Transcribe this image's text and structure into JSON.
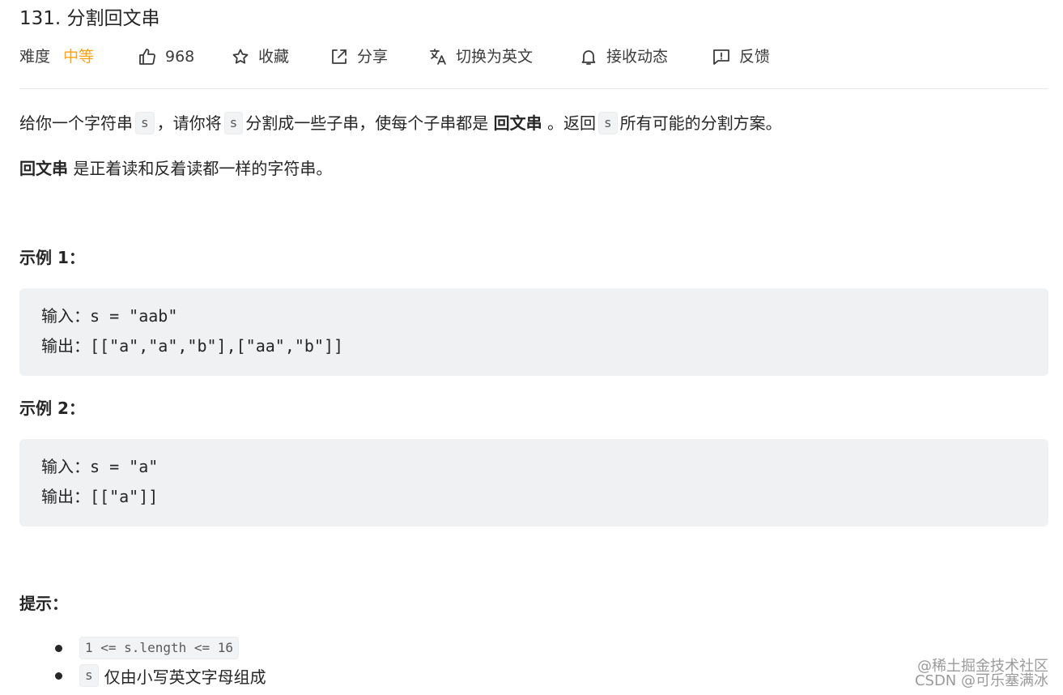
{
  "problem": {
    "title": "131. 分割回文串",
    "difficulty_label": "难度",
    "difficulty_value": "中等",
    "likes": "968",
    "favorite_label": "收藏",
    "share_label": "分享",
    "translate_label": "切换为英文",
    "notify_label": "接收动态",
    "feedback_label": "反馈"
  },
  "description": {
    "p1_part1": "给你一个字符串",
    "p1_code1": "s",
    "p1_part2": "，请你将",
    "p1_code2": "s",
    "p1_part3": "分割成一些子串，使每个子串都是",
    "p1_bold": "回文串",
    "p1_part4": "。返回",
    "p1_code3": "s",
    "p1_part5": "所有可能的分割方案。",
    "p2_bold": "回文串",
    "p2_rest": "是正着读和反着读都一样的字符串。"
  },
  "examples": [
    {
      "heading": "示例 1：",
      "input": "输入：s = \"aab\"",
      "output": "输出：[[\"a\",\"a\",\"b\"],[\"aa\",\"b\"]]"
    },
    {
      "heading": "示例 2：",
      "input": "输入：s = \"a\"",
      "output": "输出：[[\"a\"]]"
    }
  ],
  "hints": {
    "heading": "提示：",
    "items": [
      {
        "code": "1 <= s.length <= 16",
        "text": ""
      },
      {
        "code": "s",
        "text": "仅由小写英文字母组成"
      }
    ]
  },
  "watermark": {
    "line1": "@稀土掘金技术社区",
    "line2": "CSDN @可乐塞满冰"
  },
  "colors": {
    "difficulty_medium": "#ffa116",
    "code_bg": "#f0f1f2",
    "text": "#262626"
  },
  "icons": [
    "thumbs-up-icon",
    "star-icon",
    "share-icon",
    "translate-icon",
    "bell-icon",
    "feedback-icon"
  ]
}
